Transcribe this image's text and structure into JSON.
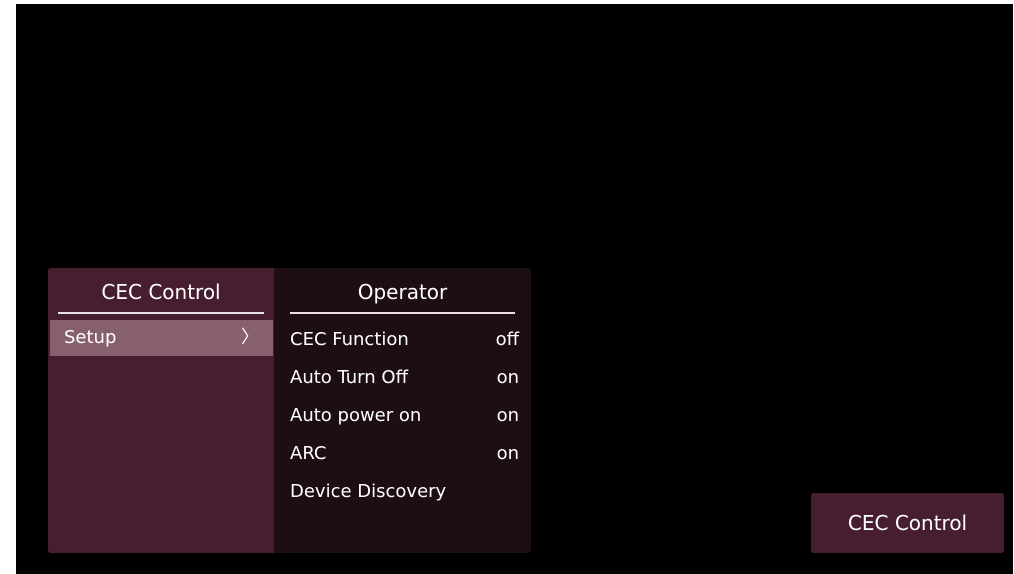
{
  "left_panel": {
    "title": "CEC Control",
    "items": [
      {
        "label": "Setup",
        "chevron": "〉"
      }
    ]
  },
  "right_panel": {
    "title": "Operator",
    "options": [
      {
        "label": "CEC Function",
        "value": "off"
      },
      {
        "label": "Auto Turn Off",
        "value": "on"
      },
      {
        "label": "Auto power on",
        "value": "on"
      },
      {
        "label": "ARC",
        "value": "on"
      },
      {
        "label": "Device Discovery",
        "value": ""
      }
    ]
  },
  "status": {
    "label": "CEC Control"
  },
  "colors": {
    "background": "#000000",
    "menu_panel": "#461e30",
    "operator_panel": "#1d0e15",
    "selected_item": "#86606f",
    "text": "#ffffff"
  }
}
